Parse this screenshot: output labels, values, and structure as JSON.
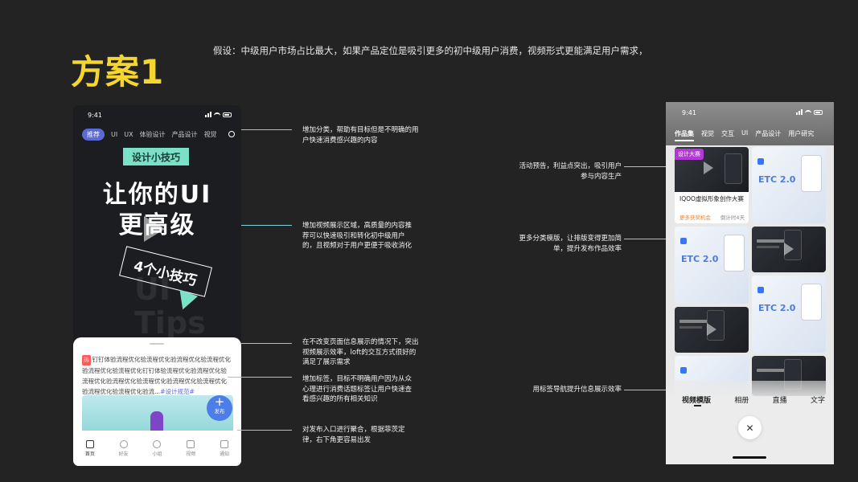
{
  "title": "方案1",
  "hypothesis": "假设：中级用户市场占比最大，如果产品定位是吸引更多的初中级用户消费，视频形式更能满足用户需求，",
  "phone1": {
    "time": "9:41",
    "categories": [
      "推荐",
      "UI",
      "UX",
      "体验设计",
      "产品设计",
      "视觉"
    ],
    "hero_tag": "设计小技巧",
    "hero_line1": "让你的UI",
    "hero_line2": "更高级",
    "hero_sticker": "4个小技巧",
    "ghost_text": "UI Tips",
    "hot_badge": "热",
    "description": "钉钉体验流程优化验流程优化验流程优化验流程优化验流程优化验流程优化钉钉体验流程优化验流程优化验流程优化验流程优化验流程优化验流程优化验流程优化验流程优化验流程优化验流...",
    "description_tag": "#设计规范#",
    "publish_label": "发布",
    "tabs": [
      "首页",
      "好友",
      "小组",
      "视频",
      "通知"
    ]
  },
  "notes_left": [
    "增加分类，帮助有目标但是不明确的用户快速消费感兴趣的内容",
    "增加视频展示区域，高质量的内容推荐可以快速吸引和转化初中级用户的，且视频对于用户更便于吸收消化",
    "在不改变页面信息展示的情况下，突出视频展示效率，loft的交互方式很好的满足了展示需求",
    "增加标签，目标不明确用户因为从众心理进行消费话题标签让用户快速查看感兴趣的所有相关知识",
    "对发布入口进行聚合，根据菲茨定律，右下角更容易出发"
  ],
  "notes_right": [
    "活动预告，利益点突出，吸引用户参与内容生产",
    "更多分类模版，让排版变得更加简单，提升发布作品效率",
    "用标签导航提升信息展示效率"
  ],
  "phone2": {
    "time": "9:41",
    "categories": [
      "作品集",
      "视觉",
      "交互",
      "UI",
      "产品设计",
      "用户研究"
    ],
    "event_tag": "设计大赛",
    "event_title": "IQOO虚拟形象创作大赛",
    "event_sub": "更多获奖机会",
    "event_days": "倒计时4天",
    "etc_text": "ETC 2.0",
    "bottom_tabs": [
      "视频模版",
      "相册",
      "直播",
      "文字"
    ],
    "close_icon": "✕"
  }
}
